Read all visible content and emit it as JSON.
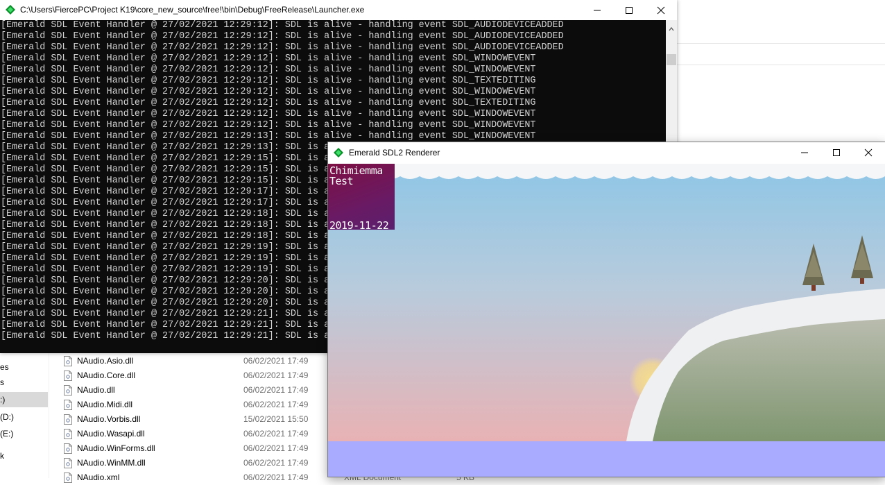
{
  "explorer": {
    "nav_items": [
      {
        "label": "es",
        "selected": false
      },
      {
        "label": "s",
        "selected": false
      },
      {
        "label": ":)",
        "selected": true
      },
      {
        "label": "(D:)",
        "selected": false
      },
      {
        "label": "(E:)",
        "selected": false
      },
      {
        "label": "k",
        "selected": false
      }
    ],
    "files": [
      {
        "name": "NAudio.Asio.dll",
        "date": "06/02/2021 17:49"
      },
      {
        "name": "NAudio.Core.dll",
        "date": "06/02/2021 17:49"
      },
      {
        "name": "NAudio.dll",
        "date": "06/02/2021 17:49"
      },
      {
        "name": "NAudio.Midi.dll",
        "date": "06/02/2021 17:49"
      },
      {
        "name": "NAudio.Vorbis.dll",
        "date": "15/02/2021 15:50"
      },
      {
        "name": "NAudio.Wasapi.dll",
        "date": "06/02/2021 17:49"
      },
      {
        "name": "NAudio.WinForms.dll",
        "date": "06/02/2021 17:49"
      },
      {
        "name": "NAudio.WinMM.dll",
        "date": "06/02/2021 17:49"
      },
      {
        "name": "NAudio.xml",
        "date": "06/02/2021 17:49"
      }
    ],
    "partial_type": "XML Document",
    "partial_size": "5 KB"
  },
  "console": {
    "title": "C:\\Users\\FiercePC\\Project K19\\core_new_source\\free!\\bin\\Debug\\FreeRelease\\Launcher.exe",
    "lines": [
      "[Emerald SDL Event Handler @ 27/02/2021 12:29:12]: SDL is alive - handling event SDL_AUDIODEVICEADDED",
      "[Emerald SDL Event Handler @ 27/02/2021 12:29:12]: SDL is alive - handling event SDL_AUDIODEVICEADDED",
      "[Emerald SDL Event Handler @ 27/02/2021 12:29:12]: SDL is alive - handling event SDL_AUDIODEVICEADDED",
      "[Emerald SDL Event Handler @ 27/02/2021 12:29:12]: SDL is alive - handling event SDL_WINDOWEVENT",
      "[Emerald SDL Event Handler @ 27/02/2021 12:29:12]: SDL is alive - handling event SDL_WINDOWEVENT",
      "[Emerald SDL Event Handler @ 27/02/2021 12:29:12]: SDL is alive - handling event SDL_TEXTEDITING",
      "[Emerald SDL Event Handler @ 27/02/2021 12:29:12]: SDL is alive - handling event SDL_WINDOWEVENT",
      "[Emerald SDL Event Handler @ 27/02/2021 12:29:12]: SDL is alive - handling event SDL_TEXTEDITING",
      "[Emerald SDL Event Handler @ 27/02/2021 12:29:12]: SDL is alive - handling event SDL_WINDOWEVENT",
      "[Emerald SDL Event Handler @ 27/02/2021 12:29:12]: SDL is alive - handling event SDL_WINDOWEVENT",
      "[Emerald SDL Event Handler @ 27/02/2021 12:29:13]: SDL is alive - handling event SDL_WINDOWEVENT",
      "[Emerald SDL Event Handler @ 27/02/2021 12:29:13]: SDL is a",
      "[Emerald SDL Event Handler @ 27/02/2021 12:29:15]: SDL is a",
      "[Emerald SDL Event Handler @ 27/02/2021 12:29:15]: SDL is a",
      "[Emerald SDL Event Handler @ 27/02/2021 12:29:15]: SDL is a",
      "[Emerald SDL Event Handler @ 27/02/2021 12:29:17]: SDL is a",
      "[Emerald SDL Event Handler @ 27/02/2021 12:29:17]: SDL is a",
      "[Emerald SDL Event Handler @ 27/02/2021 12:29:18]: SDL is a",
      "[Emerald SDL Event Handler @ 27/02/2021 12:29:18]: SDL is a",
      "[Emerald SDL Event Handler @ 27/02/2021 12:29:18]: SDL is a",
      "[Emerald SDL Event Handler @ 27/02/2021 12:29:19]: SDL is a",
      "[Emerald SDL Event Handler @ 27/02/2021 12:29:19]: SDL is a",
      "[Emerald SDL Event Handler @ 27/02/2021 12:29:19]: SDL is a",
      "[Emerald SDL Event Handler @ 27/02/2021 12:29:20]: SDL is a",
      "[Emerald SDL Event Handler @ 27/02/2021 12:29:20]: SDL is a",
      "[Emerald SDL Event Handler @ 27/02/2021 12:29:20]: SDL is a",
      "[Emerald SDL Event Handler @ 27/02/2021 12:29:21]: SDL is a",
      "[Emerald SDL Event Handler @ 27/02/2021 12:29:21]: SDL is a",
      "[Emerald SDL Event Handler @ 27/02/2021 12:29:21]: SDL is a"
    ],
    "text_color": "#d4d4d4",
    "background": "#0c0c0c"
  },
  "renderer": {
    "title": "Emerald SDL2 Renderer",
    "overlay_line1": "Chimiemma",
    "overlay_line2": "Test",
    "overlay_date": "2019-11-22",
    "ground_color": "#a8abff",
    "sky_top": "#8ec6e6",
    "sky_bottom": "#e8b2b4"
  },
  "icons": {
    "app_icon": "green-diamond-icon",
    "minimize": "minimize-icon",
    "maximize": "maximize-icon",
    "close": "close-icon",
    "file": "dll-file-icon"
  }
}
